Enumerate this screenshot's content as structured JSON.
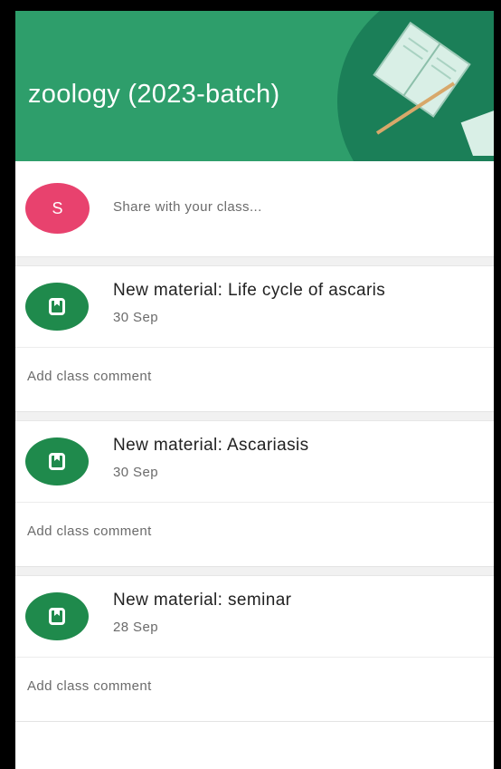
{
  "header": {
    "class_title": "zoology (2023-batch)"
  },
  "share": {
    "avatar_letter": "S",
    "placeholder": "Share with your class..."
  },
  "posts": [
    {
      "title": "New material: Life cycle of ascaris",
      "date": "30 Sep",
      "comment_label": "Add class comment"
    },
    {
      "title": "New material: Ascariasis",
      "date": "30 Sep",
      "comment_label": "Add class comment"
    },
    {
      "title": "New material: seminar",
      "date": "28 Sep",
      "comment_label": "Add class comment"
    }
  ],
  "colors": {
    "banner": "#2e9e6b",
    "avatar": "#e8426e",
    "material_icon": "#1f8a4c"
  },
  "icons": {
    "material": "bookmark-book-icon"
  }
}
